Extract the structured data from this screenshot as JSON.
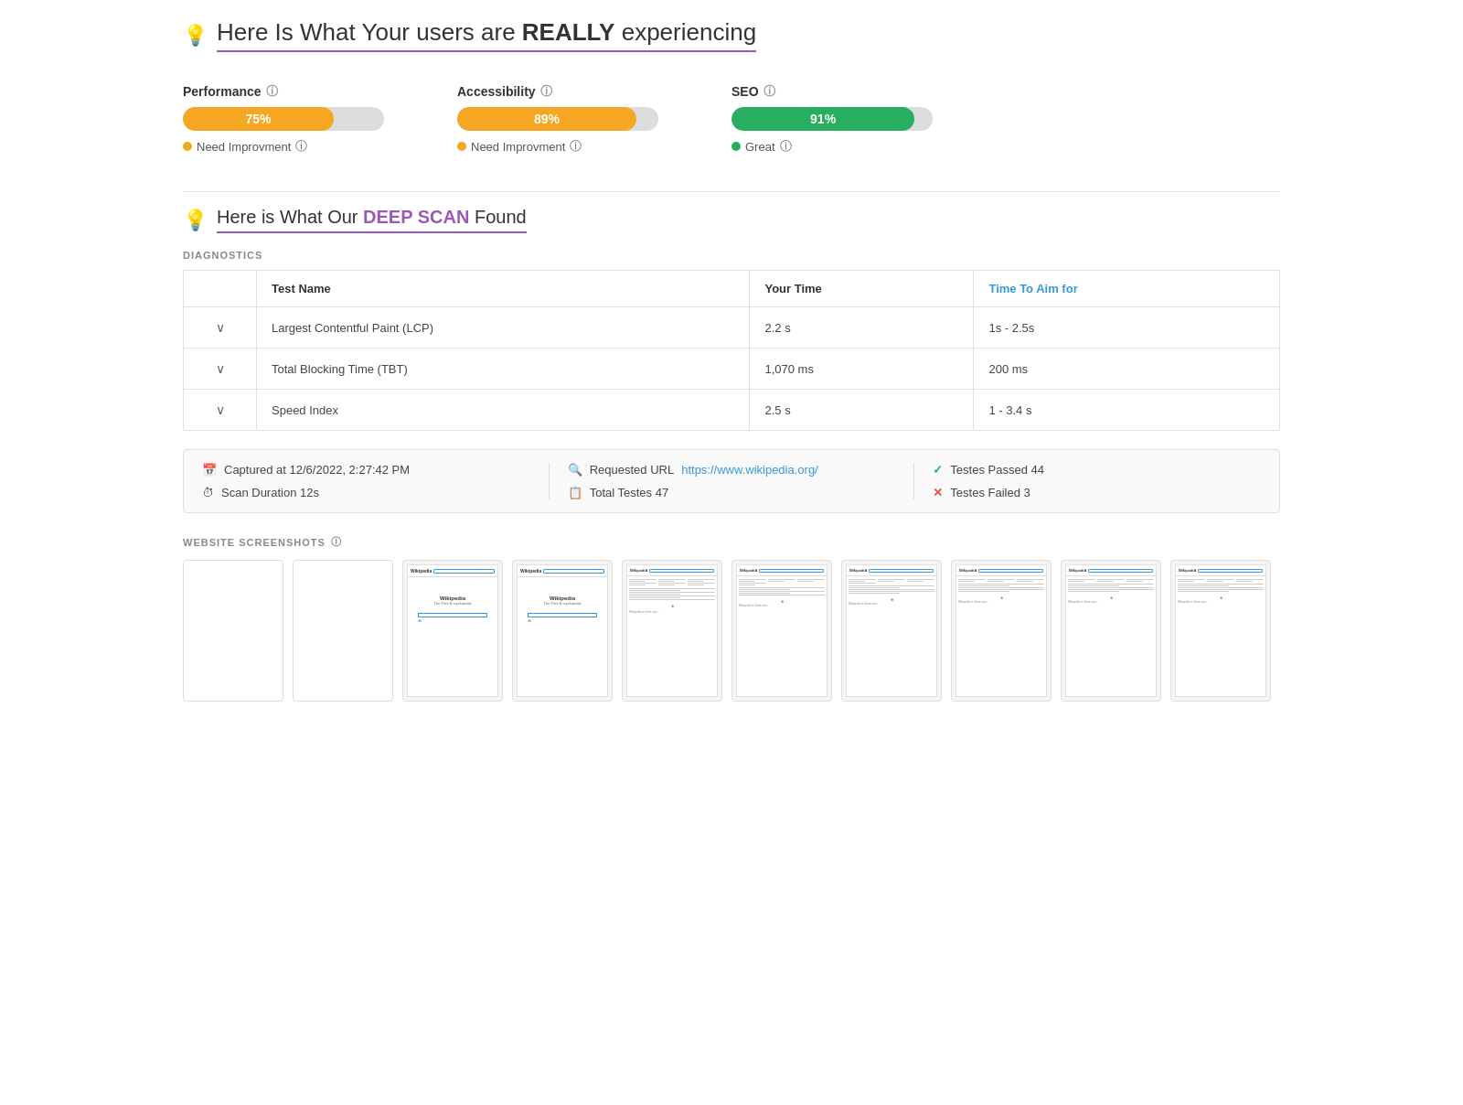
{
  "header": {
    "icon": "💡",
    "title_prefix": "Here Is What Your users are ",
    "title_bold": "REALLY",
    "title_suffix": " experiencing"
  },
  "metrics": [
    {
      "label": "Performance",
      "score": 75,
      "percent": "75%",
      "bar_color": "orange",
      "status_color": "orange",
      "status_text": "Need Improvment"
    },
    {
      "label": "Accessibility",
      "score": 89,
      "percent": "89%",
      "bar_color": "orange",
      "status_color": "orange",
      "status_text": "Need Improvment"
    },
    {
      "label": "SEO",
      "score": 91,
      "percent": "91%",
      "bar_color": "green",
      "status_color": "green",
      "status_text": "Great"
    }
  ],
  "deep_scan": {
    "icon": "💡",
    "prefix": "Here is What Our ",
    "bold": "DEEP SCAN",
    "suffix": " Found"
  },
  "diagnostics_label": "DIAGNOSTICS",
  "table": {
    "columns": [
      "",
      "Test Name",
      "Your Time",
      "Time To Aim for"
    ],
    "rows": [
      {
        "test": "Largest Contentful Paint (LCP)",
        "your_time": "2.2 s",
        "aim": "1s - 2.5s"
      },
      {
        "test": "Total Blocking Time (TBT)",
        "your_time": "1,070 ms",
        "aim": "200 ms"
      },
      {
        "test": "Speed Index",
        "your_time": "2.5 s",
        "aim": "1 - 3.4 s"
      }
    ]
  },
  "info_bar": {
    "col1": [
      {
        "icon": "📅",
        "text": "Captured at 12/6/2022, 2:27:42 PM"
      },
      {
        "icon": "⏱",
        "text": "Scan Duration 12s"
      }
    ],
    "col2": [
      {
        "icon": "🔍",
        "label": "Requested URL",
        "link": "https://www.wikipedia.org/",
        "is_link": true
      },
      {
        "icon": "📋",
        "text": "Total Testes 47"
      }
    ],
    "col3": [
      {
        "icon": "✓",
        "type": "check",
        "text": "Testes Passed 44"
      },
      {
        "icon": "✕",
        "type": "x",
        "text": "Testes Failed 3"
      }
    ]
  },
  "screenshots_label": "WEBSITE SCREENSHOTS",
  "screenshots_count": 10,
  "screenshot_types": [
    "empty",
    "empty",
    "search_only",
    "search_only",
    "full",
    "full",
    "full",
    "full",
    "full",
    "full"
  ]
}
